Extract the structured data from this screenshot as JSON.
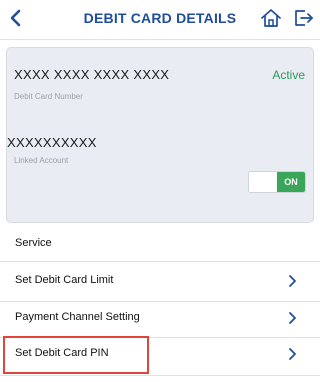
{
  "header": {
    "title": "DEBIT CARD DETAILS",
    "back_icon": "chevron-left-icon",
    "home_icon": "home-icon",
    "logout_icon": "logout-icon",
    "accent_color": "#1f4e9b"
  },
  "card": {
    "number": "XXXX XXXX XXXX XXXX",
    "number_label": "Debit Card Number",
    "status": "Active",
    "status_color": "#2c9b5b",
    "linked_account": "XXXXXXXXXX",
    "linked_account_label": "Linked Account",
    "toggle_label": "ON",
    "toggle_state": true,
    "toggle_color": "#39a659"
  },
  "service": {
    "label": "Service",
    "items": [
      {
        "label": "Set Debit Card Limit",
        "icon": "chevron-right-icon"
      },
      {
        "label": "Payment Channel Setting",
        "icon": "chevron-right-icon"
      },
      {
        "label": "Set Debit Card PIN",
        "icon": "chevron-right-icon",
        "highlighted": true
      }
    ]
  },
  "highlight_color": "#e0443a"
}
